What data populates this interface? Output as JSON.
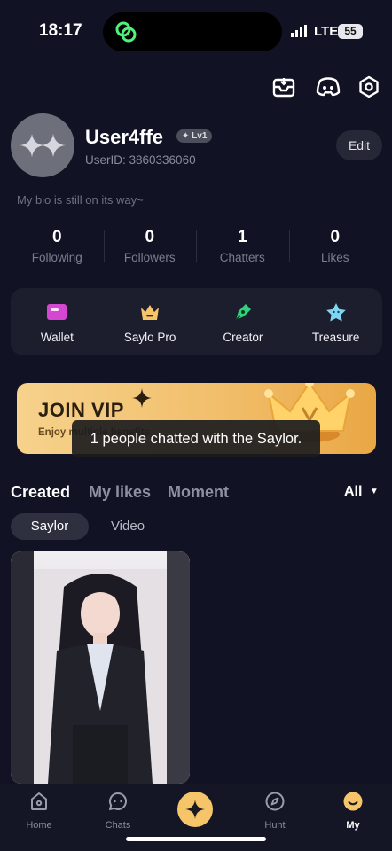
{
  "status_bar": {
    "time": "18:17",
    "network": "LTE",
    "battery": "55"
  },
  "profile": {
    "username": "User4ffe",
    "level": "✦ Lv1",
    "user_id": "UserID: 3860336060",
    "edit_label": "Edit",
    "bio": "My bio is still on its way~"
  },
  "stats": [
    {
      "value": "0",
      "label": "Following"
    },
    {
      "value": "0",
      "label": "Followers"
    },
    {
      "value": "1",
      "label": "Chatters"
    },
    {
      "value": "0",
      "label": "Likes"
    }
  ],
  "features": [
    {
      "label": "Wallet",
      "icon": "wallet-icon"
    },
    {
      "label": "Saylo Pro",
      "icon": "crown-icon"
    },
    {
      "label": "Creator",
      "icon": "pen-icon"
    },
    {
      "label": "Treasure",
      "icon": "treasure-icon"
    }
  ],
  "vip": {
    "title": "JOIN VIP",
    "subtitle": "Enjoy multiple benefits"
  },
  "tooltip": "1 people chatted with the Saylor.",
  "tabs": {
    "created": "Created",
    "likes": "My likes",
    "moment": "Moment",
    "filter": "All"
  },
  "subtabs": {
    "saylor": "Saylor",
    "video": "Video"
  },
  "nav": {
    "home": "Home",
    "chats": "Chats",
    "hunt": "Hunt",
    "my": "My"
  },
  "colors": {
    "background": "#111223",
    "accent": "#f6c56a",
    "card": "#1c1d2d"
  }
}
